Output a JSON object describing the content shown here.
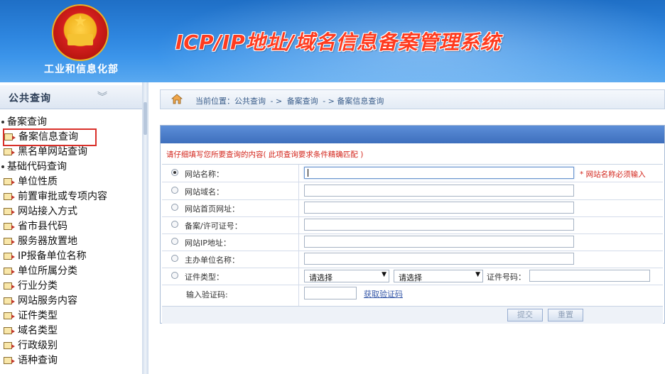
{
  "header": {
    "ministry": "工业和信息化部",
    "title": "ICP/IP地址/域名信息备案管理系统",
    "title_color": "#ff3b1f"
  },
  "sidebar": {
    "heading": "公共查询",
    "collapse_icon": "chevron-double-down-icon",
    "groups": [
      {
        "label": "备案查询",
        "items": [
          "备案信息查询",
          "黑名单网站查询"
        ]
      },
      {
        "label": "基础代码查询",
        "items": [
          "单位性质",
          "前置审批或专项内容",
          "网站接入方式",
          "省市县代码",
          "服务器放置地",
          "IP报备单位名称",
          "单位所属分类",
          "行业分类",
          "网站服务内容",
          "证件类型",
          "域名类型",
          "行政级别",
          "语种查询"
        ]
      }
    ],
    "selected_item": "备案信息查询"
  },
  "breadcrumb": {
    "prefix": "当前位置：公共查询",
    "sep": "- >",
    "level2": "备案查询",
    "level3": "- > 备案信息查询"
  },
  "form": {
    "hint": "请仔细填写您所要查询的内容( 此项查询要求条件精确匹配 )",
    "fields": [
      {
        "label": "网站名称：",
        "value": "",
        "selected": true
      },
      {
        "label": "网站域名：",
        "value": ""
      },
      {
        "label": "网站首页网址：",
        "value": ""
      },
      {
        "label": "备案/许可证号：",
        "value": ""
      },
      {
        "label": "网站IP地址：",
        "value": ""
      },
      {
        "label": "主办单位名称：",
        "value": ""
      },
      {
        "label": "证件类型："
      }
    ],
    "required_note": "* 网站名称必须输入",
    "cert_type_select1": "请选择",
    "cert_type_select2": "请选择",
    "cert_number_label": "证件号码：",
    "captcha_label": "输入验证码:",
    "captcha_link": "获取验证码",
    "submit_label": "提交",
    "reset_label": "重置"
  }
}
